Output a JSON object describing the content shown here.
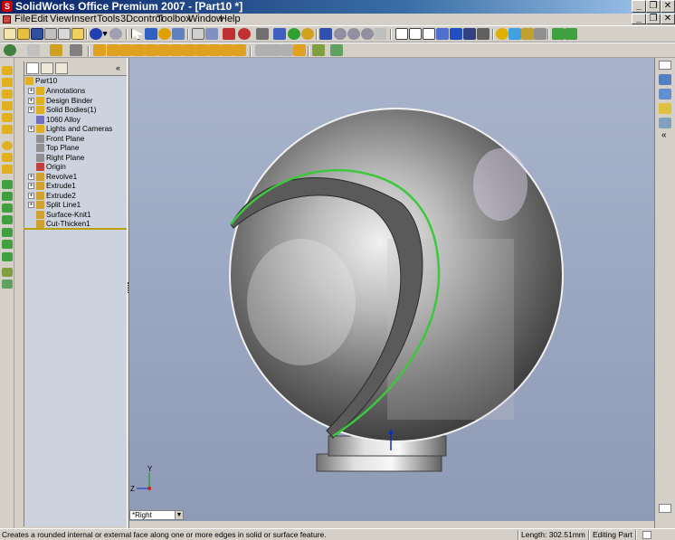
{
  "window": {
    "title": "SolidWorks Office Premium 2007 - [Part10 *]",
    "controls": {
      "minimize": "_",
      "restore": "❐",
      "close": "✕"
    },
    "child_controls": {
      "minimize": "_",
      "restore": "❐",
      "close": "✕"
    }
  },
  "menu": [
    "File",
    "Edit",
    "View",
    "Insert",
    "Tools",
    "3Dcontrol",
    "Toolbox",
    "Window",
    "Help"
  ],
  "feature_tree": {
    "root": "Part10",
    "items": [
      {
        "label": "Annotations",
        "icon": "annotations-icon",
        "color": "#e0b020",
        "expandable": true
      },
      {
        "label": "Design Binder",
        "icon": "design-binder-icon",
        "color": "#e0b020",
        "expandable": true
      },
      {
        "label": "Solid Bodies(1)",
        "icon": "solid-bodies-icon",
        "color": "#e0b020",
        "expandable": true
      },
      {
        "label": "1060 Alloy",
        "icon": "material-icon",
        "color": "#7070c0",
        "expandable": false
      },
      {
        "label": "Lights and Cameras",
        "icon": "lights-icon",
        "color": "#e0b020",
        "expandable": true
      },
      {
        "label": "Front Plane",
        "icon": "plane-icon",
        "color": "#909090",
        "expandable": false
      },
      {
        "label": "Top Plane",
        "icon": "plane-icon",
        "color": "#909090",
        "expandable": false
      },
      {
        "label": "Right Plane",
        "icon": "plane-icon",
        "color": "#909090",
        "expandable": false
      },
      {
        "label": "Origin",
        "icon": "origin-icon",
        "color": "#c04040",
        "expandable": false
      },
      {
        "label": "Revolve1",
        "icon": "revolve-icon",
        "color": "#d0a030",
        "expandable": true
      },
      {
        "label": "Extrude1",
        "icon": "extrude-icon",
        "color": "#d0a030",
        "expandable": true
      },
      {
        "label": "Extrude2",
        "icon": "extrude-icon",
        "color": "#d0a030",
        "expandable": true
      },
      {
        "label": "Split Line1",
        "icon": "split-line-icon",
        "color": "#d0a030",
        "expandable": true
      },
      {
        "label": "Surface-Knit1",
        "icon": "knit-icon",
        "color": "#d0a030",
        "expandable": false
      },
      {
        "label": "Cut-Thicken1",
        "icon": "cut-thicken-icon",
        "color": "#d0a030",
        "expandable": false
      }
    ]
  },
  "viewport": {
    "view_orientation": "*Right",
    "triad": {
      "y_label": "Y",
      "z_label": "Z"
    }
  },
  "status": {
    "message": "Creates a rounded internal or external face along one or more edges in solid or surface feature.",
    "length": "Length: 302.51mm",
    "mode": "Editing Part"
  },
  "colors": {
    "accent": "#0a246a",
    "edge_highlight": "#3cc83c",
    "viewport_bg": "#9aa6c0"
  }
}
